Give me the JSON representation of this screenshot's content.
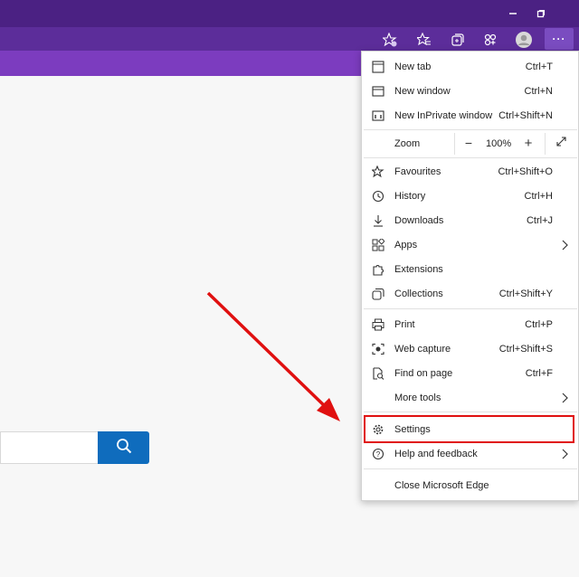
{
  "colors": {
    "titlebar": "#4b2183",
    "toolbar": "#5c2d9a",
    "tabstrip": "#7c3cbf",
    "search_button": "#0f6cbd",
    "highlight": "#e01010"
  },
  "menu": {
    "new_tab": {
      "label": "New tab",
      "shortcut": "Ctrl+T"
    },
    "new_window": {
      "label": "New window",
      "shortcut": "Ctrl+N"
    },
    "new_inprivate": {
      "label": "New InPrivate window",
      "shortcut": "Ctrl+Shift+N"
    },
    "zoom": {
      "label": "Zoom",
      "value": "100%",
      "minus": "−",
      "plus": "+"
    },
    "favourites": {
      "label": "Favourites",
      "shortcut": "Ctrl+Shift+O"
    },
    "history": {
      "label": "History",
      "shortcut": "Ctrl+H"
    },
    "downloads": {
      "label": "Downloads",
      "shortcut": "Ctrl+J"
    },
    "apps": {
      "label": "Apps"
    },
    "extensions": {
      "label": "Extensions"
    },
    "collections": {
      "label": "Collections",
      "shortcut": "Ctrl+Shift+Y"
    },
    "print": {
      "label": "Print",
      "shortcut": "Ctrl+P"
    },
    "web_capture": {
      "label": "Web capture",
      "shortcut": "Ctrl+Shift+S"
    },
    "find_on_page": {
      "label": "Find on page",
      "shortcut": "Ctrl+F"
    },
    "more_tools": {
      "label": "More tools"
    },
    "settings": {
      "label": "Settings"
    },
    "help": {
      "label": "Help and feedback"
    },
    "close_edge": {
      "label": "Close Microsoft Edge"
    }
  },
  "toolbar": {
    "more_label": "···"
  },
  "icons": [
    "minimize-icon",
    "restore-icon",
    "add-favourite-icon",
    "favourites-icon",
    "collections-icon",
    "extensions-icon",
    "profile-icon",
    "more-icon",
    "search-icon"
  ]
}
